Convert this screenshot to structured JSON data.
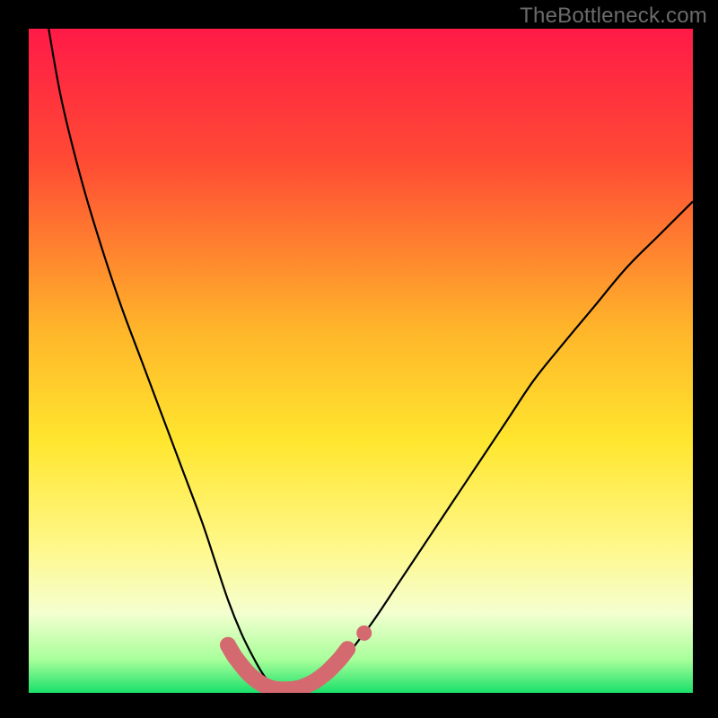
{
  "watermark": "TheBottleneck.com",
  "chart_data": {
    "type": "line",
    "title": "",
    "xlabel": "",
    "ylabel": "",
    "xlim": [
      0,
      100
    ],
    "ylim": [
      0,
      100
    ],
    "grid": false,
    "legend": false,
    "annotations": [],
    "background_gradient": [
      {
        "stop": 0.0,
        "color": "#ff1a47"
      },
      {
        "stop": 0.2,
        "color": "#ff4b34"
      },
      {
        "stop": 0.45,
        "color": "#ffb42a"
      },
      {
        "stop": 0.62,
        "color": "#ffe62e"
      },
      {
        "stop": 0.78,
        "color": "#fff88a"
      },
      {
        "stop": 0.88,
        "color": "#f4ffd0"
      },
      {
        "stop": 0.95,
        "color": "#a8ff9a"
      },
      {
        "stop": 1.0,
        "color": "#19e06a"
      }
    ],
    "series": [
      {
        "name": "bottleneck-curve",
        "color": "#000000",
        "x": [
          3,
          5,
          8,
          11,
          14,
          17,
          20,
          23,
          26,
          28,
          30,
          32,
          34,
          35.5,
          37,
          39,
          41,
          43.5,
          47,
          49,
          52,
          56,
          60,
          64,
          68,
          72,
          76,
          80,
          85,
          90,
          95,
          100
        ],
        "y": [
          100,
          89,
          77,
          67,
          58,
          50,
          42,
          34,
          26,
          20,
          14,
          9,
          5,
          2.5,
          1,
          0.3,
          0.5,
          1.5,
          4,
          7,
          11,
          17,
          23,
          29,
          35,
          41,
          47,
          52,
          58,
          64,
          69,
          74
        ]
      },
      {
        "name": "highlight-band",
        "color": "#d46a6f",
        "x": [
          30,
          31,
          32,
          33,
          34,
          35,
          36,
          37,
          38,
          39,
          40,
          41,
          42,
          43,
          44,
          45,
          46,
          47,
          48
        ],
        "y": [
          7.2,
          5.5,
          4.2,
          3.0,
          2.1,
          1.4,
          0.9,
          0.6,
          0.5,
          0.5,
          0.6,
          0.8,
          1.2,
          1.7,
          2.4,
          3.2,
          4.2,
          5.3,
          6.6
        ]
      },
      {
        "name": "highlight-dot",
        "color": "#d46a6f",
        "x": [
          50.5
        ],
        "y": [
          9.0
        ]
      }
    ]
  }
}
